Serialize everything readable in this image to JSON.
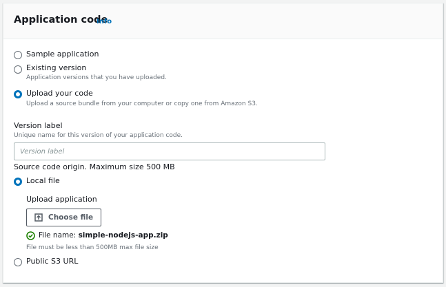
{
  "section": {
    "title": "Application code",
    "info_link": "Info"
  },
  "source_options": [
    {
      "label": "Sample application",
      "description": "",
      "checked": false
    },
    {
      "label": "Existing version",
      "description": "Application versions that you have uploaded.",
      "checked": false
    },
    {
      "label": "Upload your code",
      "description": "Upload a source bundle from your computer or copy one from Amazon S3.",
      "checked": true
    }
  ],
  "version_label": {
    "label": "Version label",
    "description": "Unique name for this version of your application code.",
    "placeholder": "Version label",
    "value": ""
  },
  "source_origin": {
    "heading": "Source code origin. Maximum size 500 MB",
    "local_file_label": "Local file",
    "local_file_checked": true,
    "public_s3_label": "Public S3 URL",
    "public_s3_checked": false
  },
  "upload": {
    "label": "Upload application",
    "button_label": "Choose file",
    "file_name_prefix": "File name: ",
    "file_name": "simple-nodejs-app.zip",
    "size_hint": "File must be less than 500MB max file size"
  },
  "colors": {
    "accent": "#0073bb",
    "success": "#1d8102",
    "text": "#16191f",
    "muted": "#687078"
  },
  "icons": {
    "upload": "upload-icon",
    "success": "check-circle-icon"
  }
}
